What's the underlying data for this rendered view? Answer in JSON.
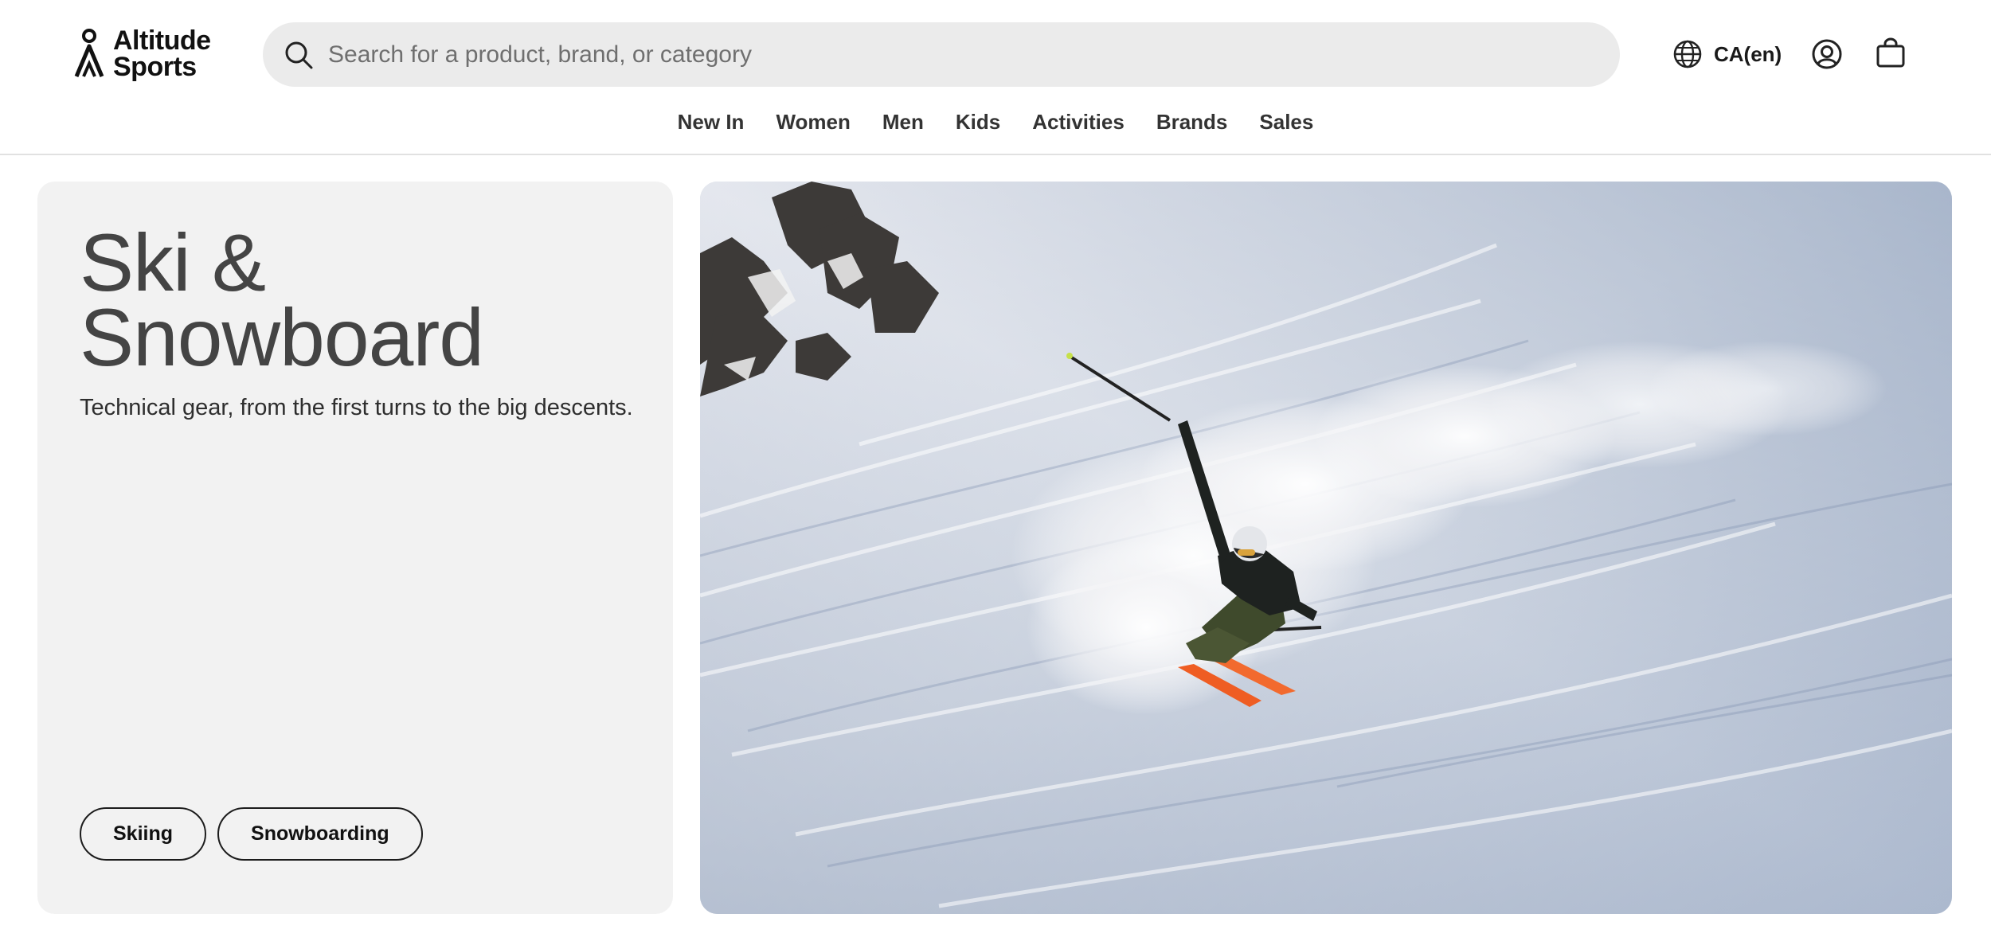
{
  "brand": {
    "line1": "Altitude",
    "line2": "Sports"
  },
  "search": {
    "placeholder": "Search for a product, brand, or category",
    "value": ""
  },
  "header": {
    "locale_label": "CA(en)"
  },
  "nav": {
    "items": [
      "New In",
      "Women",
      "Men",
      "Kids",
      "Activities",
      "Brands",
      "Sales"
    ]
  },
  "hero": {
    "title_line1": "Ski &",
    "title_line2": "Snowboard",
    "subtitle": "Technical gear, from the first turns to the big descents.",
    "buttons": [
      "Skiing",
      "Snowboarding"
    ]
  },
  "colors": {
    "panel_bg": "#f2f2f2",
    "search_bg": "#ebebeb",
    "ski_accent": "#f26a2e",
    "text_dark": "#444444"
  }
}
